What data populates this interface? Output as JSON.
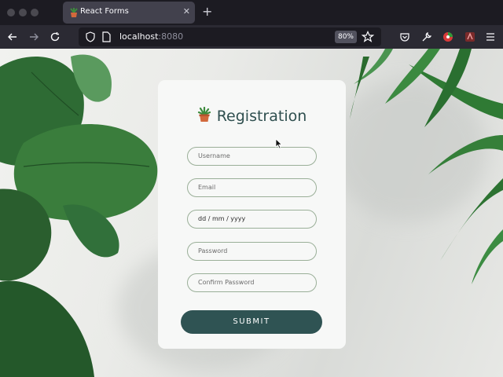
{
  "browser": {
    "tab": {
      "title": "React Forms",
      "close_glyph": "✕"
    },
    "new_tab_glyph": "+",
    "url": {
      "host": "localhost",
      "port": ":8080"
    },
    "zoom": "80%",
    "icons": [
      "back-icon",
      "forward-icon",
      "reload-icon",
      "shield-icon",
      "page-icon",
      "star-icon",
      "pocket-icon",
      "wrench-icon",
      "extension-icon",
      "extension2-icon",
      "menu-icon"
    ]
  },
  "form": {
    "title": "Registration",
    "fields": {
      "username": "Username",
      "email": "Email",
      "date": "dd / mm / yyyy",
      "password": "Password",
      "confirm": "Confirm Password"
    },
    "submit_label": "SUBMIT"
  },
  "colors": {
    "accent": "#2f5353",
    "field_border": "#9aaf98",
    "leaf": "#2e6b34"
  }
}
